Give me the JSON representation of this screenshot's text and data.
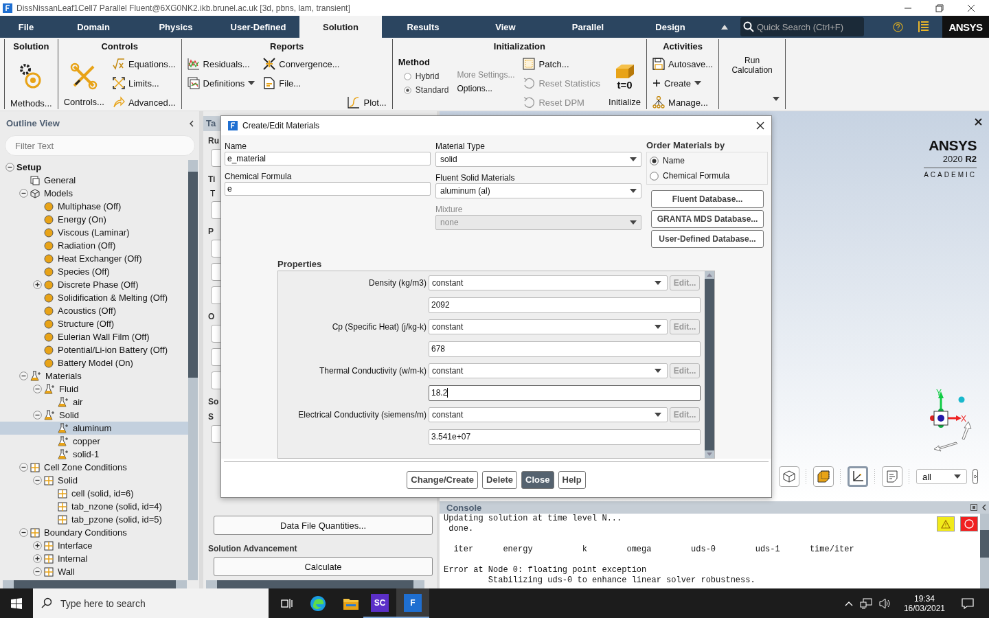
{
  "window": {
    "title": "DissNissanLeaf1Cell7 Parallel Fluent@6XG0NK2.ikb.brunel.ac.uk  [3d, pbns, lam, transient]"
  },
  "ribbon_tabs": [
    {
      "label": "File",
      "selected": false
    },
    {
      "label": "Domain",
      "selected": false
    },
    {
      "label": "Physics",
      "selected": false
    },
    {
      "label": "User-Defined",
      "selected": false
    },
    {
      "label": "Solution",
      "selected": true
    },
    {
      "label": "Results",
      "selected": false
    },
    {
      "label": "View",
      "selected": false
    },
    {
      "label": "Parallel",
      "selected": false
    },
    {
      "label": "Design",
      "selected": false
    }
  ],
  "quick_search": {
    "placeholder": "Quick Search (Ctrl+F)"
  },
  "brand": "ANSYS",
  "ribbon": [
    {
      "title": "Solution",
      "columns": [
        [
          {
            "kind": "large",
            "label": "Methods..."
          }
        ]
      ]
    },
    {
      "title": "Controls",
      "columns": [
        [
          {
            "kind": "large",
            "label": "Controls..."
          }
        ],
        [
          {
            "kind": "small",
            "label": "Equations..."
          },
          {
            "kind": "small",
            "label": "Limits..."
          },
          {
            "kind": "small",
            "label": "Advanced..."
          }
        ]
      ]
    },
    {
      "title": "Reports",
      "columns": [
        [
          {
            "kind": "small",
            "label": "Residuals..."
          },
          {
            "kind": "small",
            "label": "Definitions",
            "menu": true
          }
        ],
        [
          {
            "kind": "small",
            "label": "Convergence..."
          },
          {
            "kind": "small",
            "label": "File..."
          }
        ],
        [
          {
            "kind": "small",
            "label": "Plot..."
          }
        ]
      ]
    },
    {
      "title": "Initialization",
      "columns": [
        [
          {
            "kind": "heading",
            "label": "Method"
          },
          {
            "kind": "radio",
            "label": "Hybrid",
            "selected": false
          },
          {
            "kind": "radio",
            "label": "Standard",
            "selected": true
          }
        ],
        [
          {
            "kind": "text",
            "label": "More Settings...",
            "disabled": true
          },
          {
            "kind": "text",
            "label": "Options...",
            "disabled": false
          }
        ],
        [
          {
            "kind": "small",
            "label": "Patch...",
            "disabled": false
          },
          {
            "kind": "small",
            "label": "Reset Statistics",
            "disabled": true
          },
          {
            "kind": "small",
            "label": "Reset DPM",
            "disabled": true
          }
        ],
        [
          {
            "kind": "large",
            "label": "Initialize",
            "badge": "t=0"
          }
        ]
      ]
    },
    {
      "title": "Activities",
      "columns": [
        [
          {
            "kind": "small",
            "label": "Autosave..."
          },
          {
            "kind": "small",
            "label": "Create",
            "menu": true
          },
          {
            "kind": "small",
            "label": "Manage..."
          }
        ]
      ]
    },
    {
      "columns": [
        [
          {
            "kind": "plain",
            "label": "Run Calculation",
            "menu": true
          }
        ]
      ]
    }
  ],
  "outline": {
    "title": "Outline View",
    "filter": {
      "placeholder": "Filter Text"
    },
    "tree": [
      {
        "label": "Setup",
        "expanded": true,
        "selected": false,
        "children": [
          {
            "label": "General",
            "selected": false
          },
          {
            "label": "Models",
            "expanded": true,
            "selected": false,
            "children": [
              {
                "label": "Multiphase (Off)",
                "selected": false
              },
              {
                "label": "Energy (On)",
                "selected": false
              },
              {
                "label": "Viscous (Laminar)",
                "selected": false
              },
              {
                "label": "Radiation (Off)",
                "selected": false
              },
              {
                "label": "Heat Exchanger (Off)",
                "selected": false
              },
              {
                "label": "Species (Off)",
                "selected": false
              },
              {
                "label": "Discrete Phase (Off)",
                "expanded": false,
                "selected": false
              },
              {
                "label": "Solidification & Melting (Off)",
                "selected": false
              },
              {
                "label": "Acoustics (Off)",
                "selected": false
              },
              {
                "label": "Structure (Off)",
                "selected": false
              },
              {
                "label": "Eulerian Wall Film (Off)",
                "selected": false
              },
              {
                "label": "Potential/Li-ion Battery (Off)",
                "selected": false
              },
              {
                "label": "Battery Model (On)",
                "selected": false
              }
            ]
          },
          {
            "label": "Materials",
            "expanded": true,
            "selected": false,
            "children": [
              {
                "label": "Fluid",
                "expanded": true,
                "selected": false,
                "children": [
                  {
                    "label": "air",
                    "selected": false
                  }
                ]
              },
              {
                "label": "Solid",
                "expanded": true,
                "selected": false,
                "children": [
                  {
                    "label": "aluminum",
                    "selected": true
                  },
                  {
                    "label": "copper",
                    "selected": false
                  },
                  {
                    "label": "solid-1",
                    "selected": false
                  }
                ]
              }
            ]
          },
          {
            "label": "Cell Zone Conditions",
            "expanded": true,
            "selected": false,
            "children": [
              {
                "label": "Solid",
                "expanded": true,
                "selected": false,
                "children": [
                  {
                    "label": "cell (solid, id=6)",
                    "selected": false
                  },
                  {
                    "label": "tab_nzone (solid, id=4)",
                    "selected": false
                  },
                  {
                    "label": "tab_pzone (solid, id=5)",
                    "selected": false
                  }
                ]
              }
            ]
          },
          {
            "label": "Boundary Conditions",
            "expanded": true,
            "selected": false,
            "children": [
              {
                "label": "Interface",
                "expanded": false,
                "selected": false
              },
              {
                "label": "Internal",
                "expanded": false,
                "selected": false
              },
              {
                "label": "Wall",
                "expanded": true,
                "selected": false
              }
            ]
          }
        ]
      }
    ]
  },
  "task_panel": {
    "tab": "Ta",
    "fragments": [
      {
        "kind": "heading",
        "text": "Ru"
      },
      {
        "kind": "field"
      },
      {
        "kind": "heading",
        "text": "Ti"
      },
      {
        "kind": "label",
        "text": "T"
      },
      {
        "kind": "field"
      },
      {
        "kind": "heading",
        "text": "P"
      },
      {
        "kind": "field"
      },
      {
        "kind": "field"
      },
      {
        "kind": "field"
      },
      {
        "kind": "heading",
        "text": "O"
      },
      {
        "kind": "field"
      },
      {
        "kind": "field"
      },
      {
        "kind": "field"
      },
      {
        "kind": "heading",
        "text": "So"
      },
      {
        "kind": "heading",
        "text": "S"
      },
      {
        "kind": "field"
      }
    ],
    "data_button": "Data File Quantities...",
    "advancement": {
      "title": "Solution Advancement",
      "button": "Calculate"
    }
  },
  "dialog": {
    "title": "Create/Edit Materials",
    "name": {
      "label": "Name",
      "value": "e_material"
    },
    "formula": {
      "label": "Chemical Formula",
      "value": "e"
    },
    "material_type": {
      "label": "Material Type",
      "value": "solid"
    },
    "materials": {
      "label": "Fluent Solid Materials",
      "value": "aluminum (al)"
    },
    "mixture": {
      "label": "Mixture",
      "value": "none",
      "disabled": true
    },
    "order_by": {
      "label": "Order Materials by",
      "options": [
        {
          "label": "Name",
          "selected": true
        },
        {
          "label": "Chemical Formula",
          "selected": false
        }
      ]
    },
    "database_buttons": [
      "Fluent Database...",
      "GRANTA MDS Database...",
      "User-Defined Database..."
    ],
    "properties": {
      "label": "Properties",
      "rows": [
        {
          "label": "Density (kg/m3)",
          "method": "constant",
          "edit": "Edit...",
          "edit_disabled": true,
          "value": "2092",
          "focused": false
        },
        {
          "label": "Cp (Specific Heat) (j/kg-k)",
          "method": "constant",
          "edit": "Edit...",
          "edit_disabled": true,
          "value": "678",
          "focused": false
        },
        {
          "label": "Thermal Conductivity (w/m-k)",
          "method": "constant",
          "edit": "Edit...",
          "edit_disabled": true,
          "value": "18.2",
          "focused": true
        },
        {
          "label": "Electrical Conductivity (siemens/m)",
          "method": "constant",
          "edit": "Edit...",
          "edit_disabled": true,
          "value": "3.541e+07",
          "focused": false
        }
      ]
    },
    "buttons": [
      {
        "label": "Change/Create",
        "primary": false
      },
      {
        "label": "Delete",
        "primary": false
      },
      {
        "label": "Close",
        "primary": true
      },
      {
        "label": "Help",
        "primary": false
      }
    ]
  },
  "graphics": {
    "logo": "ANSYS",
    "version": "2020 **R2**",
    "edition": "ACADEMIC",
    "axis_labels": {
      "y": "Y",
      "x": "X"
    },
    "toolbar": [
      {
        "selected": false
      },
      {
        "selected": false
      },
      {
        "selected": true
      },
      {
        "selected": false
      }
    ],
    "view_select": "all"
  },
  "console": {
    "title": "Console",
    "lines": [
      "Updating solution at time level N...",
      " done.",
      "  iter      energy          k        omega        uds-0        uds-1      time/iter",
      "Error at Node 0: floating point exception",
      "         Stabilizing uds-0 to enhance linear solver robustness."
    ]
  },
  "taskbar": {
    "search": {
      "placeholder": "Type here to search"
    },
    "apps": [
      {
        "label": "SC",
        "selected": false
      },
      {
        "label": "F",
        "selected": true
      }
    ],
    "time": "19:34",
    "date": "16/03/2021"
  }
}
